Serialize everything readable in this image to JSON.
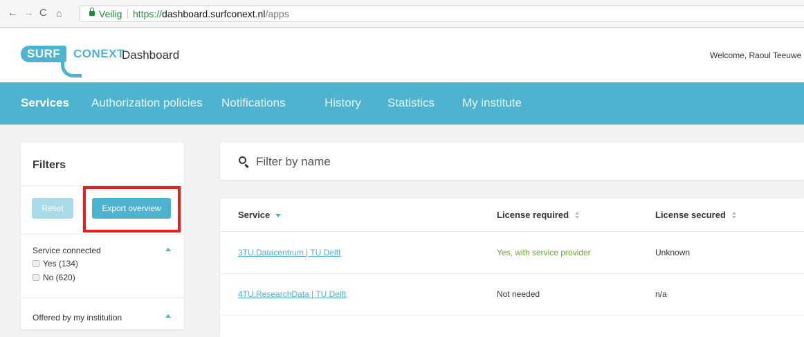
{
  "browser": {
    "secure_label": "Veilig",
    "url_scheme": "https://",
    "url_host": "dashboard.surfconext.nl",
    "url_path": "/apps",
    "icons": [
      "back-arrow-icon",
      "forward-arrow-icon",
      "reload-icon",
      "home-icon",
      "lock-icon"
    ]
  },
  "header": {
    "logo_surf": "SURF",
    "logo_conext": "CONEXT",
    "title": "Dashboard",
    "welcome": "Welcome, Raoul Teeuwe"
  },
  "nav": {
    "items": [
      {
        "label": "Services",
        "active": true
      },
      {
        "label": "Authorization policies",
        "active": false
      },
      {
        "label": "Notifications",
        "active": false
      },
      {
        "label": "History",
        "active": false
      },
      {
        "label": "Statistics",
        "active": false
      },
      {
        "label": "My institute",
        "active": false
      }
    ]
  },
  "filters": {
    "title": "Filters",
    "reset_label": "Reset",
    "export_label": "Export overview",
    "sections": [
      {
        "title": "Service connected",
        "options": [
          "Yes (134)",
          "No (620)"
        ]
      },
      {
        "title": "Offered by my institution",
        "options": []
      }
    ]
  },
  "search": {
    "placeholder": "Filter by name"
  },
  "table": {
    "columns": [
      "Service",
      "License required",
      "License secured"
    ],
    "rows": [
      {
        "service": "3TU.Datacentrum | TU Delft",
        "license_required": "Yes, with service provider",
        "license_secured": "Unknown"
      },
      {
        "service": "4TU.ResearchData | TU Delft",
        "license_required": "Not needed",
        "license_secured": "n/a"
      }
    ]
  },
  "colors": {
    "brand": "#4db3cf",
    "highlight": "#ee1c1c",
    "positive": "#6aa829"
  }
}
